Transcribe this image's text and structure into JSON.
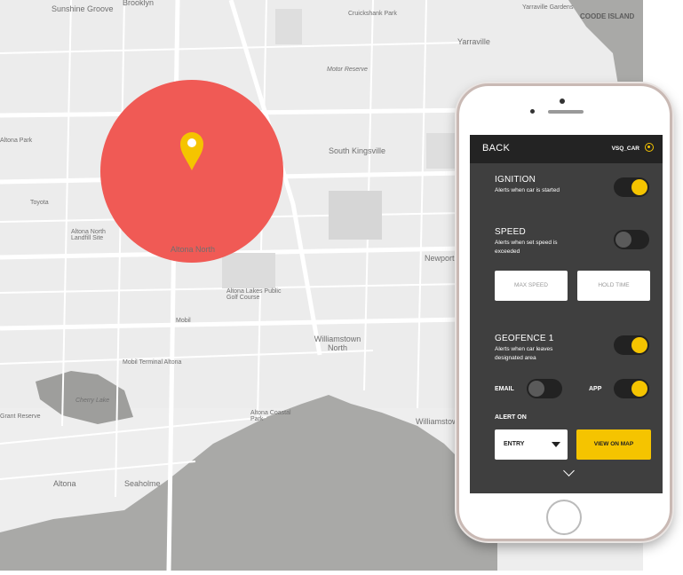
{
  "map": {
    "labels": {
      "sunshine_groove": "Sunshine Groove",
      "brooklyn": "Brooklyn",
      "cruickshank_park": "Cruickshank Park",
      "yarraville_gardens": "Yarraville Gardens",
      "coode_island": "COODE ISLAND",
      "yarraville": "Yarraville",
      "motor_reserve": "Motor Reserve",
      "altona_park": "Altona Park",
      "toyota": "Toyota",
      "south_kingsville": "South Kingsville",
      "altona_north_landfill": "Altona North Landfill Site",
      "altona_north": "Altona North",
      "altona_lakes_golf": "Altona Lakes Public Golf Course",
      "mobil": "Mobil",
      "williamstown_north": "Williamstown North",
      "mobil_terminal": "Mobil Terminal Altona",
      "cherry_lake": "Cherry Lake",
      "grant_reserve": "Grant Reserve",
      "altona_coastal_park": "Altona Coastal Park",
      "altona": "Altona",
      "seaholme": "Seaholme",
      "williamstown": "Williamstown",
      "newport": "Newport"
    },
    "geofence_color": "#f05a55",
    "pin_color": "#f5c400"
  },
  "phone": {
    "header": {
      "back_label": "BACK",
      "vehicle_name": "VSQ_CAR"
    },
    "ignition": {
      "title": "IGNITION",
      "subtitle": "Alerts when car is started",
      "enabled": true
    },
    "speed": {
      "title": "SPEED",
      "subtitle": "Alerts when set speed is exceeded",
      "enabled": false,
      "max_speed_label": "MAX SPEED",
      "hold_time_label": "HOLD TIME"
    },
    "geofence": {
      "title": "GEOFENCE 1",
      "subtitle": "Alerts when car leaves designated area",
      "enabled": true,
      "email_label": "EMAIL",
      "email_enabled": false,
      "app_label": "APP",
      "app_enabled": true,
      "alert_on_label": "ALERT ON",
      "alert_on_value": "ENTRY",
      "view_on_map_label": "VIEW ON MAP"
    },
    "accent_color": "#f5c400"
  }
}
